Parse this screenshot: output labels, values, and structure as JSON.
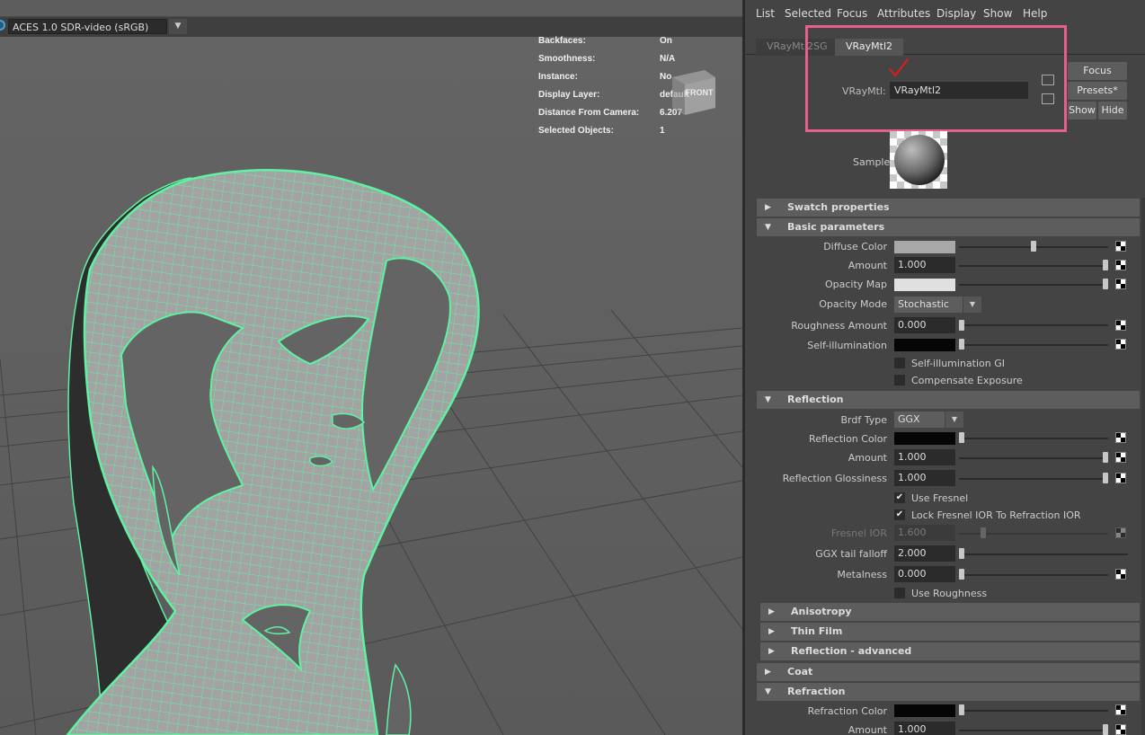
{
  "viewport": {
    "color_management": "ACES 1.0 SDR-video (sRGB)",
    "hud": [
      {
        "label": "Backfaces:",
        "value": "On"
      },
      {
        "label": "Smoothness:",
        "value": "N/A"
      },
      {
        "label": "Instance:",
        "value": "No"
      },
      {
        "label": "Display Layer:",
        "value": "default"
      },
      {
        "label": "Distance From Camera:",
        "value": "6.207"
      },
      {
        "label": "Selected Objects:",
        "value": "1"
      }
    ],
    "viewcube_face": "FRONT",
    "wire_color": "#5ff2a2"
  },
  "attribute_editor": {
    "menu": [
      "List",
      "Selected",
      "Focus",
      "Attributes",
      "Display",
      "Show",
      "Help"
    ],
    "tabs": [
      "VRayMtl2SG",
      "VRayMtl2"
    ],
    "material_label": "VRayMtl:",
    "material_name": "VRayMtl2",
    "buttons": {
      "focus": "Focus",
      "presets": "Presets*",
      "show": "Show",
      "hide": "Hide"
    },
    "sample_label": "Sample",
    "sections": {
      "swatch": "Swatch properties",
      "basic": "Basic parameters",
      "reflection": "Reflection",
      "anisotropy": "Anisotropy",
      "thin_film": "Thin Film",
      "reflection_adv": "Reflection - advanced",
      "coat": "Coat",
      "refraction": "Refraction"
    },
    "basic": {
      "diffuse_color": {
        "label": "Diffuse Color",
        "slider": 0.5
      },
      "amount": {
        "label": "Amount",
        "value": "1.000",
        "slider": 1.0
      },
      "opacity_map": {
        "label": "Opacity Map",
        "slider": 1.0
      },
      "opacity_mode": {
        "label": "Opacity Mode",
        "value": "Stochastic"
      },
      "roughness": {
        "label": "Roughness Amount",
        "value": "0.000",
        "slider": 0.0
      },
      "self_illum": {
        "label": "Self-illumination",
        "slider": 0.0
      },
      "self_illum_gi": {
        "label": "Self-illumination GI",
        "checked": false
      },
      "comp_exposure": {
        "label": "Compensate Exposure",
        "checked": false
      }
    },
    "reflection": {
      "brdf": {
        "label": "Brdf Type",
        "value": "GGX"
      },
      "color": {
        "label": "Reflection Color",
        "slider": 0.0
      },
      "amount": {
        "label": "Amount",
        "value": "1.000",
        "slider": 1.0
      },
      "glossiness": {
        "label": "Reflection Glossiness",
        "value": "1.000",
        "slider": 1.0
      },
      "use_fresnel": {
        "label": "Use Fresnel",
        "checked": true
      },
      "lock_fresnel": {
        "label": "Lock Fresnel IOR To Refraction IOR",
        "checked": true
      },
      "fresnel_ior": {
        "label": "Fresnel IOR",
        "value": "1.600",
        "slider": 0.15
      },
      "ggx_tail": {
        "label": "GGX tail falloff",
        "value": "2.000",
        "slider": 0.0
      },
      "metalness": {
        "label": "Metalness",
        "value": "0.000",
        "slider": 0.0
      },
      "use_roughness": {
        "label": "Use Roughness",
        "checked": false
      }
    },
    "refraction": {
      "color": {
        "label": "Refraction Color",
        "slider": 0.0
      },
      "amount": {
        "label": "Amount",
        "value": "1.000",
        "slider": 1.0
      }
    }
  }
}
